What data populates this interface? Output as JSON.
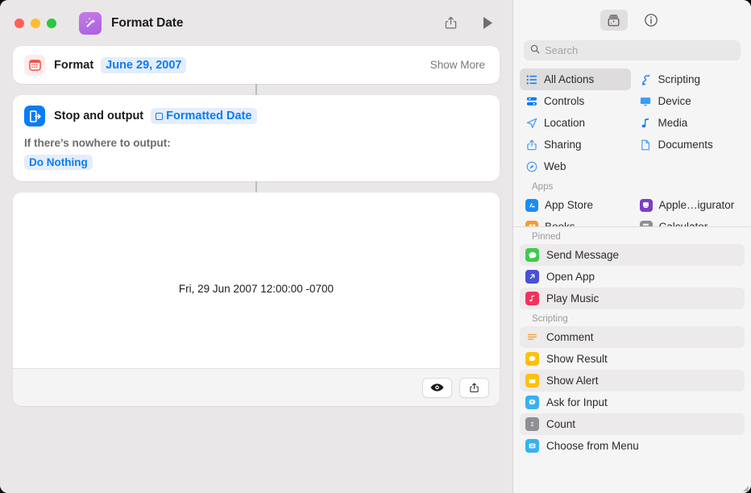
{
  "window": {
    "title": "Format Date",
    "app_icon": "magic-wand-icon",
    "accent_blue": "#0a7cf6",
    "background": "#e9e7e8"
  },
  "titlebar": {
    "traffic_lights": [
      {
        "name": "close",
        "color": "#ff5f57"
      },
      {
        "name": "minimize",
        "color": "#febc2e"
      },
      {
        "name": "zoom",
        "color": "#28c840"
      }
    ],
    "share_icon": "share-icon",
    "run_icon": "play-icon"
  },
  "flow": {
    "format_action": {
      "icon": "calendar-icon",
      "label": "Format",
      "value_token": "June 29, 2007",
      "show_more": "Show More"
    },
    "stop_action": {
      "icon": "stop-and-output-icon",
      "label": "Stop and output",
      "token": "Formatted Date",
      "token_glyph": "variable-square-icon",
      "subtitle": "If there’s nowhere to output:",
      "fallback_token": "Do Nothing"
    },
    "result": {
      "text": "Fri, 29 Jun 2007 12:00:00 -0700",
      "quicklook_icon": "eye-icon",
      "share_icon": "share-icon"
    }
  },
  "library": {
    "toolbar": {
      "add_action_icon": "action-library-icon",
      "info_icon": "info-circle-icon"
    },
    "search": {
      "icon": "search-icon",
      "placeholder": "Search",
      "value": ""
    },
    "categories": [
      {
        "label": "All Actions",
        "icon": "list-bullet-icon",
        "selected": true,
        "color": "#0a7cf6"
      },
      {
        "label": "Scripting",
        "icon": "scripting-icon",
        "selected": false,
        "color": "#0a7cf6"
      },
      {
        "label": "Controls",
        "icon": "controls-icon",
        "selected": false,
        "color": "#0a7cf6"
      },
      {
        "label": "Device",
        "icon": "display-icon",
        "selected": false,
        "color": "#3b9cf7"
      },
      {
        "label": "Location",
        "icon": "location-icon",
        "selected": false,
        "color": "#4d9ef8"
      },
      {
        "label": "Media",
        "icon": "music-note-icon",
        "selected": false,
        "color": "#0a7cf6"
      },
      {
        "label": "Sharing",
        "icon": "share-icon",
        "selected": false,
        "color": "#4d9ef8"
      },
      {
        "label": "Documents",
        "icon": "document-icon",
        "selected": false,
        "color": "#4d9ef8"
      },
      {
        "label": "Web",
        "icon": "safari-icon",
        "selected": false,
        "color": "#4d9ef8"
      }
    ],
    "apps_header": "Apps",
    "apps": [
      {
        "label": "App Store",
        "icon": "app-store-icon",
        "color": "#1a8cf8"
      },
      {
        "label": "Apple…igurator",
        "icon": "apple-configurator-icon",
        "color": "#7b3fc4"
      },
      {
        "label": "Books",
        "icon": "books-icon",
        "color": "#f79a2c"
      },
      {
        "label": "Calculator",
        "icon": "calculator-icon",
        "color": "#8e8e93"
      }
    ],
    "pinned_header": "Pinned",
    "pinned": [
      {
        "label": "Send Message",
        "icon": "messages-icon",
        "color": "#3ecb4d"
      },
      {
        "label": "Open App",
        "icon": "open-app-icon",
        "color": "#4a4fd8"
      },
      {
        "label": "Play Music",
        "icon": "play-music-icon",
        "color": "#f2315c"
      }
    ],
    "scripting_header": "Scripting",
    "scripting": [
      {
        "label": "Comment",
        "icon": "comment-icon",
        "color": "#f2a33c"
      },
      {
        "label": "Show Result",
        "icon": "show-result-icon",
        "color": "#ffc107"
      },
      {
        "label": "Show Alert",
        "icon": "show-alert-icon",
        "color": "#ffc107"
      },
      {
        "label": "Ask for Input",
        "icon": "ask-input-icon",
        "color": "#37b1f5"
      },
      {
        "label": "Count",
        "icon": "count-icon",
        "color": "#8e8e93"
      },
      {
        "label": "Choose from Menu",
        "icon": "menu-icon",
        "color": "#37b1f5"
      }
    ]
  }
}
